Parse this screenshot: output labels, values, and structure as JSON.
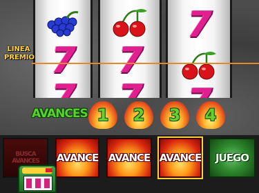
{
  "game": {
    "payline_label": "LINEA PREMIO",
    "payline_color": "#e08a2a",
    "reels": [
      {
        "symbols": [
          "grapes",
          "seven",
          "seven"
        ]
      },
      {
        "symbols": [
          "cherries",
          "seven",
          "seven"
        ]
      },
      {
        "symbols": [
          "seven",
          "cherries",
          "seven"
        ]
      }
    ],
    "seven_glyph": "7",
    "avances": {
      "label": "AVANCES",
      "numbers": [
        "1",
        "2",
        "3",
        "4"
      ]
    },
    "buttons": [
      {
        "label": "BUSCA AVANCES",
        "style": "dark"
      },
      {
        "label": "AVANCE",
        "style": "fire"
      },
      {
        "label": "AVANCE",
        "style": "fire"
      },
      {
        "label": "AVANCE",
        "style": "fire"
      },
      {
        "label": "JUEGO",
        "style": "green"
      }
    ]
  }
}
